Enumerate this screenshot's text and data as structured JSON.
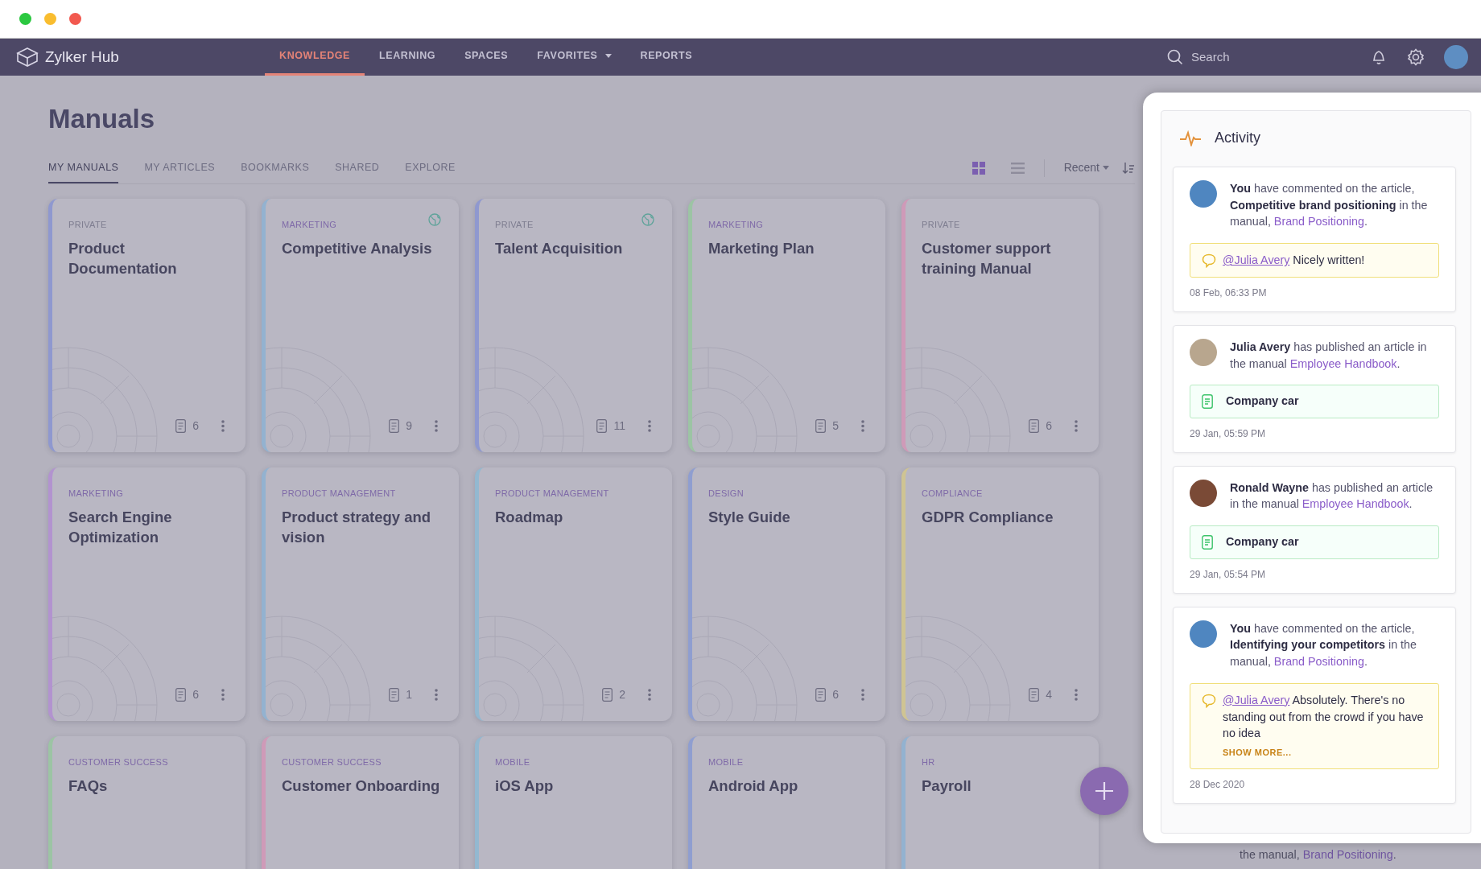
{
  "app": {
    "name": "Zylker Hub"
  },
  "nav": {
    "tabs": [
      {
        "label": "KNOWLEDGE",
        "selected": true,
        "dropdown": false
      },
      {
        "label": "LEARNING",
        "selected": false,
        "dropdown": false
      },
      {
        "label": "SPACES",
        "selected": false,
        "dropdown": false
      },
      {
        "label": "FAVORITES",
        "selected": false,
        "dropdown": true
      },
      {
        "label": "REPORTS",
        "selected": false,
        "dropdown": false
      }
    ],
    "search": {
      "placeholder": "Search"
    }
  },
  "page": {
    "title": "Manuals",
    "tabs": [
      {
        "label": "MY MANUALS",
        "selected": true
      },
      {
        "label": "MY ARTICLES",
        "selected": false
      },
      {
        "label": "BOOKMARKS",
        "selected": false
      },
      {
        "label": "SHARED",
        "selected": false
      },
      {
        "label": "EXPLORE",
        "selected": false
      }
    ],
    "view": {
      "grid_selected": true
    },
    "sort": {
      "label": "Recent"
    }
  },
  "manuals": [
    {
      "category": "PRIVATE",
      "category_muted": true,
      "title": "Product Documentation",
      "count": "6",
      "shared": false,
      "color": "#8f98cf"
    },
    {
      "category": "MARKETING",
      "category_muted": false,
      "title": "Competitive Analysis",
      "count": "9",
      "shared": true,
      "color": "#93b2d0"
    },
    {
      "category": "PRIVATE",
      "category_muted": true,
      "title": "Talent Acquisition",
      "count": "11",
      "shared": true,
      "color": "#8f98cf"
    },
    {
      "category": "MARKETING",
      "category_muted": false,
      "title": "Marketing Plan",
      "count": "5",
      "shared": false,
      "color": "#9cc4a4"
    },
    {
      "category": "PRIVATE",
      "category_muted": true,
      "title": "Customer support training Manual",
      "count": "6",
      "shared": false,
      "color": "#cf9ab8"
    },
    {
      "category": "MARKETING",
      "category_muted": false,
      "title": "Search Engine Optimization",
      "count": "6",
      "shared": false,
      "color": "#b293cf"
    },
    {
      "category": "PRODUCT MANAGEMENT",
      "category_muted": false,
      "title": "Product strategy and vision",
      "count": "1",
      "shared": false,
      "color": "#93b2d0"
    },
    {
      "category": "PRODUCT MANAGEMENT",
      "category_muted": false,
      "title": "Roadmap",
      "count": "2",
      "shared": false,
      "color": "#93b8d0"
    },
    {
      "category": "DESIGN",
      "category_muted": false,
      "title": "Style Guide",
      "count": "6",
      "shared": false,
      "color": "#8f9ed0"
    },
    {
      "category": "COMPLIANCE",
      "category_muted": false,
      "title": "GDPR Compliance",
      "count": "4",
      "shared": false,
      "color": "#cfc493"
    },
    {
      "category": "CUSTOMER SUCCESS",
      "category_muted": false,
      "title": "FAQs",
      "color": "#9cc4a4",
      "shared": false
    },
    {
      "category": "CUSTOMER SUCCESS",
      "category_muted": false,
      "title": "Customer Onboarding",
      "color": "#cf9ab8",
      "shared": false
    },
    {
      "category": "MOBILE",
      "category_muted": false,
      "title": "iOS App",
      "color": "#93b8d0",
      "shared": false
    },
    {
      "category": "MOBILE",
      "category_muted": false,
      "title": "Android App",
      "color": "#8f9ed0",
      "shared": false
    },
    {
      "category": "HR",
      "category_muted": false,
      "title": "Payroll",
      "color": "#93b2d0",
      "shared": false
    }
  ],
  "background_activity": {
    "text": "the manual, ",
    "link": "Brand Positioning",
    "after": "."
  },
  "activity": {
    "title": "Activity",
    "items": [
      {
        "kind": "comment",
        "text": "**You** have commented on the article, **Competitive brand positioning** in the manual, ",
        "link": "Brand Positioning",
        "after": ".",
        "mention": "@Julia Avery",
        "comment": " Nicely written!",
        "time": "08 Feb, 06:33 PM"
      },
      {
        "kind": "article",
        "text": "**Julia Avery** has published an article in the manual ",
        "link": "Employee Handbook",
        "after": ".",
        "article": "Company car",
        "time": "29 Jan, 05:59 PM"
      },
      {
        "kind": "article",
        "text": "**Ronald Wayne** has published an article in the manual ",
        "link": "Employee Handbook",
        "after": ".",
        "article": "Company car",
        "time": "29 Jan, 05:54 PM"
      },
      {
        "kind": "comment",
        "text": "**You** have commented on the article, **Identifying your competitors** in the manual, ",
        "link": "Brand Positioning",
        "after": ".",
        "mention": "@Julia Avery",
        "comment": " Absolutely. There's no standing out from the crowd if you have no idea",
        "more": "SHOW MORE...",
        "time": "28 Dec 2020"
      }
    ]
  }
}
